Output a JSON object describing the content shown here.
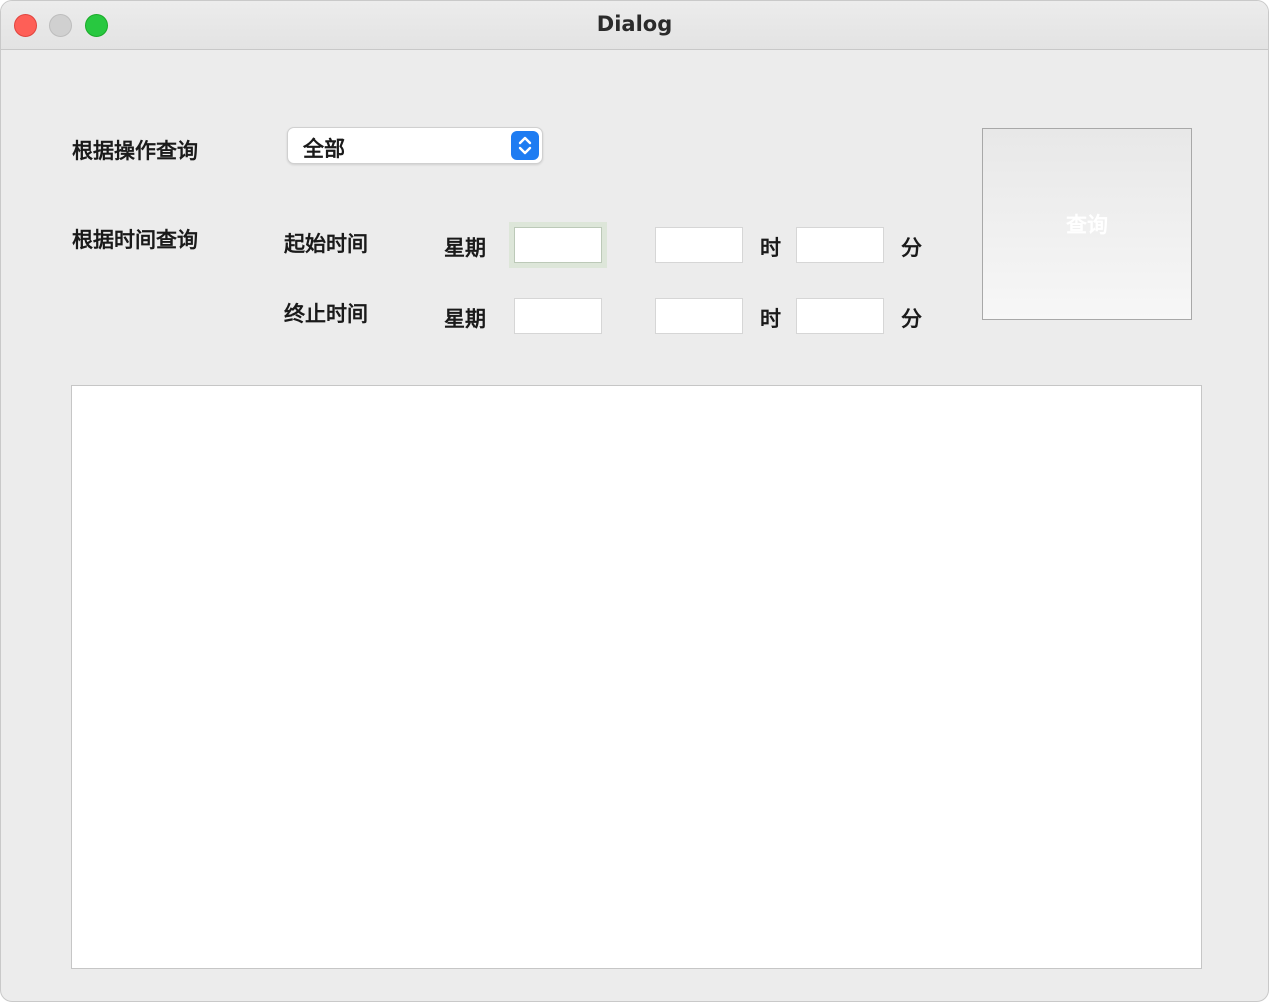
{
  "window": {
    "title": "Dialog"
  },
  "operation_query": {
    "label": "根据操作查询",
    "selected": "全部"
  },
  "time_query": {
    "label": "根据时间查询",
    "start": {
      "label": "起始时间",
      "weekday_label": "星期",
      "hour_label": "时",
      "minute_label": "分",
      "weekday": "",
      "hour": "",
      "minute": ""
    },
    "end": {
      "label": "终止时间",
      "weekday_label": "星期",
      "hour_label": "时",
      "minute_label": "分",
      "weekday": "",
      "hour": "",
      "minute": ""
    }
  },
  "query_button": {
    "label": "查询"
  },
  "results": {
    "text": ""
  },
  "colors": {
    "accent": "#1e7cf2",
    "close": "#fe5f57",
    "maximize": "#28c840"
  }
}
